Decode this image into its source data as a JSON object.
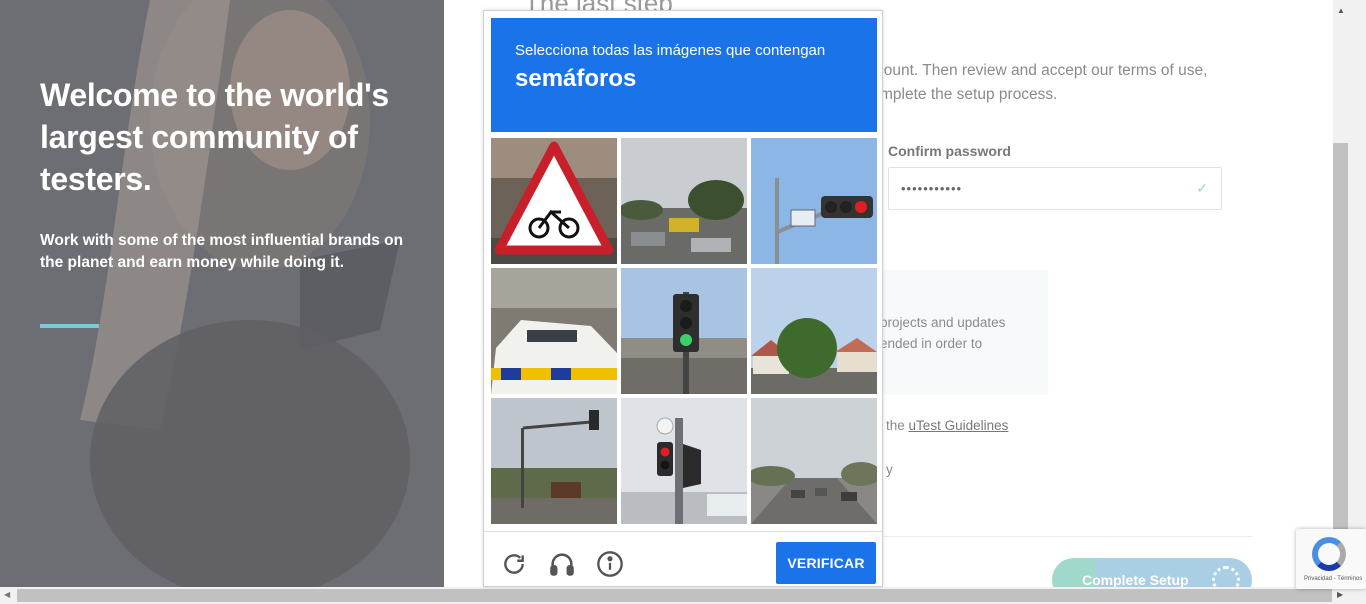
{
  "hero": {
    "title": "Welcome to the world's largest community of testers.",
    "subtitle": "Work with some of the most influential brands on the planet and earn money while doing it."
  },
  "form": {
    "step_title": "The last step",
    "intro_line1": "count. Then review and accept our terms of use,",
    "intro_line2": "mplete the setup process.",
    "confirm_password_label": "Confirm password",
    "confirm_password_value": "•••••••••••",
    "info_line1": "projects and updates",
    "info_line2": "ended in order to",
    "guidelines_prefix": "the",
    "guidelines_link": "uTest Guidelines",
    "policy_fragment": "y",
    "complete_button": "Complete Setup"
  },
  "captcha": {
    "instruction": "Selecciona todas las imágenes que contengan",
    "keyword": "semáforos",
    "verify_label": "VERIFICAR",
    "tiles": [
      {
        "icon": "bicycle-warning-sign-photo"
      },
      {
        "icon": "street-cars-photo"
      },
      {
        "icon": "traffic-light-red-photo"
      },
      {
        "icon": "police-car-photo"
      },
      {
        "icon": "traffic-light-green-photo"
      },
      {
        "icon": "houses-trees-photo"
      },
      {
        "icon": "traffic-light-pole-photo"
      },
      {
        "icon": "traffic-light-red-close-photo"
      },
      {
        "icon": "highway-cars-photo"
      }
    ]
  },
  "recaptcha_badge": {
    "footer_text": "Privacidad - Términos"
  },
  "colors": {
    "captcha_blue": "#1a73e8",
    "hero_accent": "#7ec7d8",
    "check_green": "#9fd7c5"
  }
}
